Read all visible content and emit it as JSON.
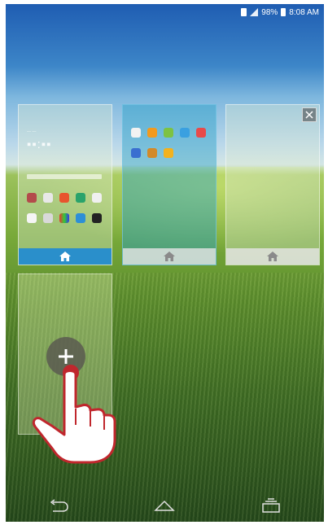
{
  "status_bar": {
    "battery_percent": "98%",
    "time": "8:08 AM",
    "icons": [
      "sim-icon",
      "signal-icon",
      "battery-icon"
    ]
  },
  "screens": [
    {
      "name": "home-screen",
      "is_home": true,
      "footer_icon": "home-icon"
    },
    {
      "name": "screen-2",
      "is_home": false,
      "footer_icon": "home-icon"
    },
    {
      "name": "screen-3",
      "is_home": false,
      "footer_icon": "home-icon",
      "has_close": true,
      "close_icon": "close-icon"
    }
  ],
  "add_screen": {
    "icon": "plus-icon"
  },
  "pointer": {
    "icon": "hand-pointer-icon"
  },
  "nav": {
    "icons": [
      "back-icon",
      "home-icon",
      "recent-apps-icon"
    ]
  },
  "colors": {
    "accent": "#2a8fcb",
    "pointer_red": "#c0272d"
  }
}
